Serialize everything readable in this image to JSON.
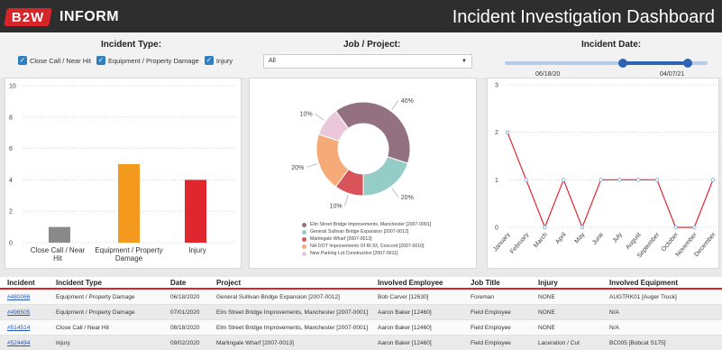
{
  "header": {
    "logo_text": "B2W",
    "brand": "INFORM",
    "title": "Incident Investigation Dashboard"
  },
  "filters": {
    "incident_type_title": "Incident Type:",
    "types": [
      "Close Call / Near Hit",
      "Equipment / Property Damage",
      "Injury"
    ],
    "project_title": "Job / Project:",
    "project_value": "All",
    "date_title": "Incident Date:",
    "date_start": "06/18/20",
    "date_end": "04/07/21",
    "date_range_fraction": [
      0.58,
      0.9
    ]
  },
  "colors": {
    "accent": "#d7252a",
    "checkbox": "#2d7fc1",
    "slider": "#2d65b2"
  },
  "chart_data": [
    {
      "type": "bar",
      "categories": [
        "Close Call / Near Hit",
        "Equipment / Property Damage",
        "Injury"
      ],
      "values": [
        1,
        5,
        4
      ],
      "colors": [
        "#8a8a8a",
        "#f39a1e",
        "#e0262e"
      ],
      "ylim": [
        0,
        10
      ],
      "yticks": [
        0,
        2,
        4,
        6,
        8,
        10
      ],
      "grid": true
    },
    {
      "type": "pie",
      "hole": true,
      "labels": [
        "Elm Street Bridge Improvements, Manchester [2007-0001]",
        "General Sullivan Bridge Expansion [2007-0012]",
        "Martingale Wharf [2007-0013]",
        "NH DOT Improvements Of Rt 93, Concord [2007-0010]",
        "New Parking Lot Construction [2007-0011]"
      ],
      "values": [
        40,
        20,
        10,
        20,
        10
      ],
      "slice_labels": [
        "40%",
        "20%",
        "10%",
        "20%",
        "10%"
      ],
      "colors": [
        "#947181",
        "#94ccc6",
        "#d9535a",
        "#f5aa78",
        "#eac7db"
      ],
      "legend": "bottom"
    },
    {
      "type": "line",
      "categories": [
        "January",
        "February",
        "March",
        "April",
        "May",
        "June",
        "July",
        "August",
        "September",
        "October",
        "November",
        "December"
      ],
      "values": [
        2,
        1,
        0,
        1,
        0,
        1,
        1,
        1,
        1,
        0,
        0,
        1
      ],
      "color": "#e0262e",
      "ylim": [
        0,
        3
      ],
      "yticks": [
        0,
        1,
        2,
        3
      ],
      "grid": true
    }
  ],
  "table": {
    "headers": [
      "Incident",
      "Incident Type",
      "Date",
      "Project",
      "Involved Employee",
      "Job Title",
      "Injury",
      "Involved Equipment"
    ],
    "rows": [
      [
        "#480066",
        "Equipment / Property Damage",
        "06/18/2020",
        "General Sullivan Bridge Expansion [2007-0012]",
        "Bob Carver [12630]",
        "Foreman",
        "NONE",
        "AUGTRK01 [Auger Truck]"
      ],
      [
        "#498505",
        "Equipment / Property Damage",
        "07/01/2020",
        "Elm Street Bridge Improvements, Manchester [2007-0001]",
        "Aaron Baker [12460]",
        "Field Employee",
        "NONE",
        "N/A"
      ],
      [
        "#514514",
        "Close Call / Near Hit",
        "08/18/2020",
        "Elm Street Bridge Improvements, Manchester [2007-0001]",
        "Aaron Baker [12460]",
        "Field Employee",
        "NONE",
        "N/A"
      ],
      [
        "#524494",
        "Injury",
        "09/02/2020",
        "Martingale Wharf [2007-0013]",
        "Aaron Baker [12460]",
        "Field Employee",
        "Laceration / Cut",
        "BC005 [Bobcat S175]"
      ]
    ]
  }
}
